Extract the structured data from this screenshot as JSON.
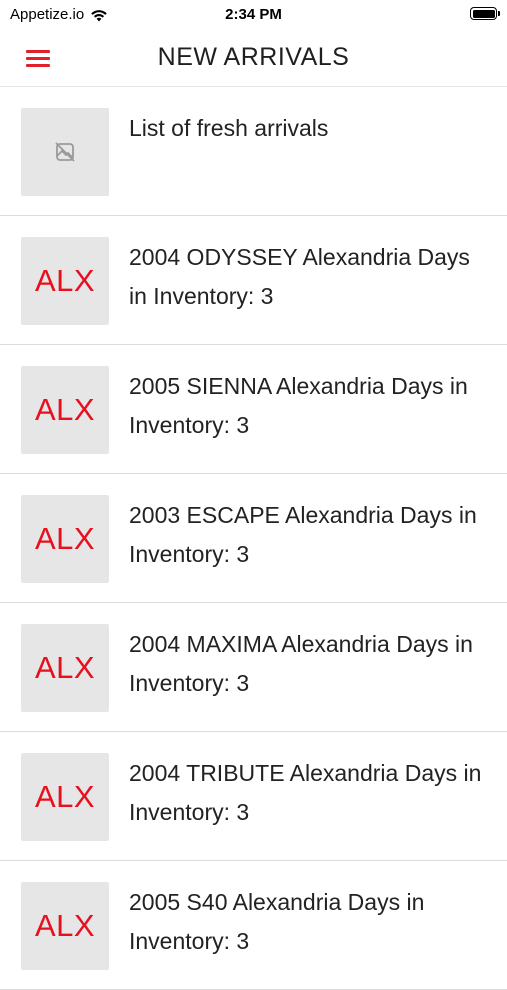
{
  "status_bar": {
    "carrier": "Appetize.io",
    "time": "2:34 PM"
  },
  "nav": {
    "title": "NEW ARRIVALS",
    "menu_icon": "hamburger-menu-icon",
    "accent_color": "#e0202a"
  },
  "list": {
    "header_item": {
      "text": "List of fresh arrivals",
      "icon": "broken-image-icon"
    },
    "items": [
      {
        "thumb": "ALX",
        "text": "2004 ODYSSEY Alexandria Days in Inventory: 3"
      },
      {
        "thumb": "ALX",
        "text": "2005 SIENNA Alexandria Days in Inventory: 3"
      },
      {
        "thumb": "ALX",
        "text": "2003 ESCAPE Alexandria Days in Inventory: 3"
      },
      {
        "thumb": "ALX",
        "text": "2004 MAXIMA Alexandria Days in Inventory: 3"
      },
      {
        "thumb": "ALX",
        "text": "2004 TRIBUTE Alexandria Days in Inventory: 3"
      },
      {
        "thumb": "ALX",
        "text": "2005 S40 Alexandria Days in Inventory: 3"
      }
    ]
  }
}
